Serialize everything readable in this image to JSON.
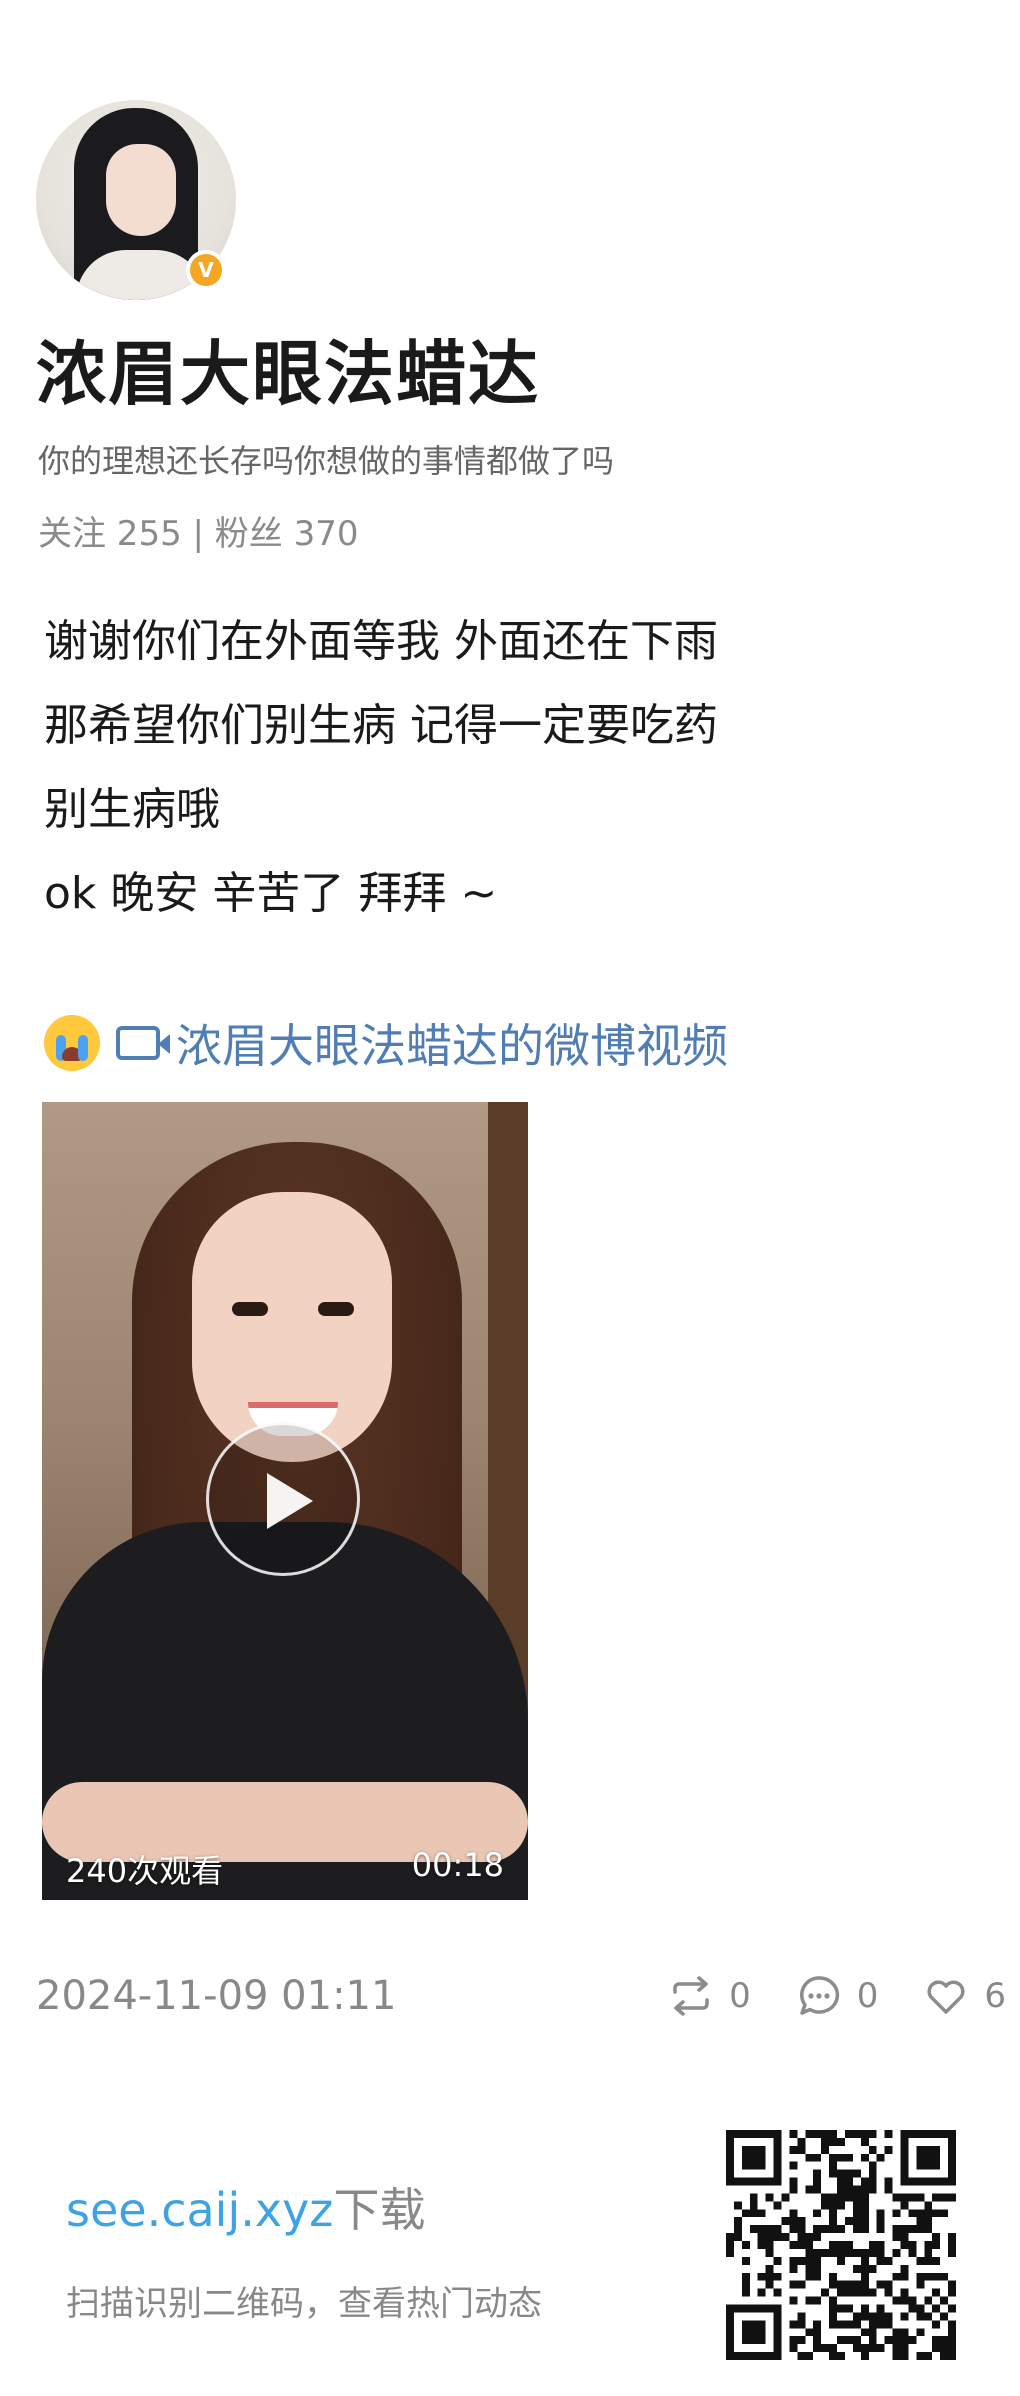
{
  "profile": {
    "username": "浓眉大眼法蜡达",
    "bio": "你的理想还长存吗你想做的事情都做了吗",
    "stats": "关注 255 | 粉丝 370",
    "verified_mark": "V"
  },
  "post": {
    "lines": [
      "谢谢你们在外面等我 外面还在下雨",
      "那希望你们别生病 记得一定要吃药",
      "别生病哦",
      "ok 晚安 辛苦了 拜拜 ~"
    ],
    "video_link_text": "浓眉大眼法蜡达的微博视频",
    "video": {
      "views": "240次观看",
      "duration": "00:18"
    },
    "timestamp": "2024-11-09 01:11",
    "actions": {
      "repost_count": "0",
      "comment_count": "0",
      "like_count": "6"
    }
  },
  "promo": {
    "domain": "see.caij.xyz",
    "suffix": "下载",
    "hint": "扫描识别二维码，查看热门动态"
  },
  "colors": {
    "link_blue": "#4f7db4",
    "promo_blue": "#3ea3e3",
    "verified_orange": "#f5a623",
    "muted_gray": "#888888"
  }
}
